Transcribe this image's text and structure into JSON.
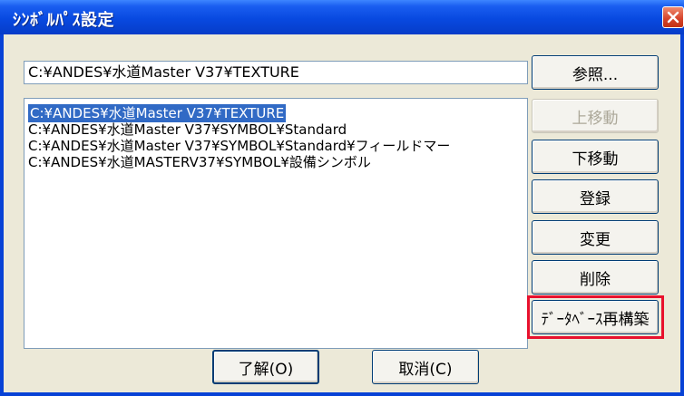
{
  "window": {
    "title": "ｼﾝﾎﾞﾙﾊﾟｽ設定"
  },
  "path_input": {
    "value": "C:¥ANDES¥水道Master V37¥TEXTURE"
  },
  "list": {
    "items": [
      {
        "label": "C:¥ANDES¥水道Master V37¥TEXTURE",
        "selected": true
      },
      {
        "label": "C:¥ANDES¥水道Master V37¥SYMBOL¥Standard",
        "selected": false
      },
      {
        "label": "C:¥ANDES¥水道Master V37¥SYMBOL¥Standard¥フィールドマー",
        "selected": false
      },
      {
        "label": "C:¥ANDES¥水道MASTERV37¥SYMBOL¥設備シンボル",
        "selected": false
      }
    ]
  },
  "buttons": {
    "browse": "参照...",
    "move_up": "上移動",
    "move_down": "下移動",
    "register": "登録",
    "change": "変更",
    "delete": "削除",
    "rebuild_db": "ﾃﾞｰﾀﾍﾞｰｽ再構築",
    "ok": "了解(O)",
    "cancel": "取消(C)"
  },
  "colors": {
    "highlight": "#e8112d",
    "selection": "#316ac5",
    "titlebar": "#0849e0"
  },
  "icons": {
    "close": "close-icon"
  }
}
